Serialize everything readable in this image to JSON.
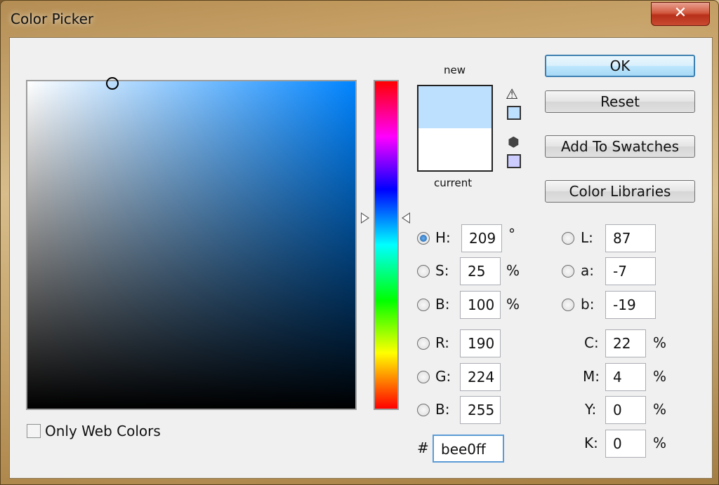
{
  "window": {
    "title": "Color Picker",
    "close_glyph": "✕"
  },
  "icons": {
    "gamut_warning": "warning-triangle-icon",
    "web_safe": "cube-icon"
  },
  "colors": {
    "new": "#bee0ff",
    "current": "#ffffff",
    "web_safe_swatch": "#ccccff"
  },
  "swatch": {
    "new_label": "new",
    "current_label": "current"
  },
  "buttons": {
    "ok": "OK",
    "reset": "Reset",
    "add_to_swatches": "Add To Swatches",
    "color_libraries": "Color Libraries"
  },
  "hsb": {
    "h": {
      "label": "H:",
      "value": "209",
      "unit": "°",
      "checked": true
    },
    "s": {
      "label": "S:",
      "value": "25",
      "unit": "%"
    },
    "b": {
      "label": "B:",
      "value": "100",
      "unit": "%"
    }
  },
  "rgb": {
    "r": {
      "label": "R:",
      "value": "190"
    },
    "g": {
      "label": "G:",
      "value": "224"
    },
    "b": {
      "label": "B:",
      "value": "255"
    }
  },
  "lab": {
    "l": {
      "label": "L:",
      "value": "87"
    },
    "a": {
      "label": "a:",
      "value": "-7"
    },
    "b": {
      "label": "b:",
      "value": "-19"
    }
  },
  "cmyk": {
    "c": {
      "label": "C:",
      "value": "22",
      "unit": "%"
    },
    "m": {
      "label": "M:",
      "value": "4",
      "unit": "%"
    },
    "y": {
      "label": "Y:",
      "value": "0",
      "unit": "%"
    },
    "k": {
      "label": "K:",
      "value": "0",
      "unit": "%"
    }
  },
  "hex": {
    "label": "#",
    "value": "bee0ff"
  },
  "only_web_colors": {
    "label": "Only Web Colors",
    "checked": false
  }
}
